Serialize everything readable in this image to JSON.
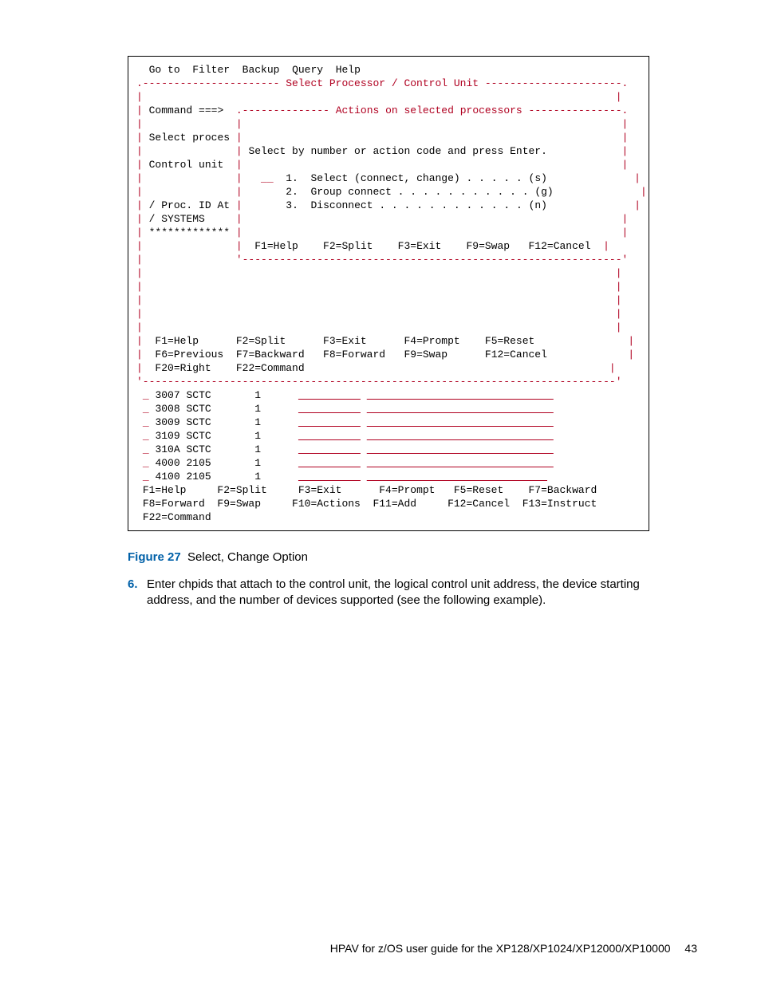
{
  "menu": {
    "items": [
      "Go to",
      "Filter",
      "Backup",
      "Query",
      "Help"
    ]
  },
  "panel": {
    "title": "Select Processor / Control Unit",
    "command_label": "Command ===>",
    "popup_title": "Actions on selected processors",
    "left_labels": {
      "select_proces": "Select proces",
      "control_unit": "Control unit",
      "proc_id_at": "/ Proc. ID At",
      "systems": "/ SYSTEMS",
      "stars": "*************"
    },
    "popup_instruction": "Select by number or action code and press Enter.",
    "actions": [
      {
        "n": "1.",
        "label": "Select (connect, change)",
        "dots": " . . . . . ",
        "code": "(s)"
      },
      {
        "n": "2.",
        "label": "Group connect",
        "dots": " . . . . . . . . . . . ",
        "code": "(g)"
      },
      {
        "n": "3.",
        "label": "Disconnect",
        "dots": " . . . . . . . . . . . . ",
        "code": "(n)"
      }
    ],
    "popup_fkeys": "F1=Help    F2=Split    F3=Exit    F9=Swap   F12=Cancel",
    "mid_fkeys_l1": "F1=Help      F2=Split      F3=Exit      F4=Prompt    F5=Reset",
    "mid_fkeys_l2": "F6=Previous  F7=Backward   F8=Forward   F9=Swap      F12=Cancel",
    "mid_fkeys_l3": "F20=Right    F22=Command",
    "rows": [
      {
        "sel": "_",
        "id": "3007",
        "type": "SCTC",
        "n": "1"
      },
      {
        "sel": "_",
        "id": "3008",
        "type": "SCTC",
        "n": "1"
      },
      {
        "sel": "_",
        "id": "3009",
        "type": "SCTC",
        "n": "1"
      },
      {
        "sel": "_",
        "id": "3109",
        "type": "SCTC",
        "n": "1"
      },
      {
        "sel": "_",
        "id": "310A",
        "type": "SCTC",
        "n": "1"
      },
      {
        "sel": "_",
        "id": "4000",
        "type": "2105",
        "n": "1"
      },
      {
        "sel": "_",
        "id": "4100",
        "type": "2105",
        "n": "1"
      }
    ],
    "bottom_fkeys_l1": "F1=Help     F2=Split     F3=Exit      F4=Prompt   F5=Reset    F7=Backward",
    "bottom_fkeys_l2": "F8=Forward  F9=Swap     F10=Actions  F11=Add     F12=Cancel  F13=Instruct",
    "bottom_fkeys_l3": "F22=Command"
  },
  "figure": {
    "label": "Figure 27",
    "caption": "Select, Change Option"
  },
  "step": {
    "number": "6.",
    "text": "Enter chpids that attach to the control unit, the logical control unit address, the device starting address, and the number of devices supported (see the following example)."
  },
  "footer": {
    "text": "HPAV for z/OS user guide for the XP128/XP1024/XP12000/XP10000",
    "page": "43"
  }
}
